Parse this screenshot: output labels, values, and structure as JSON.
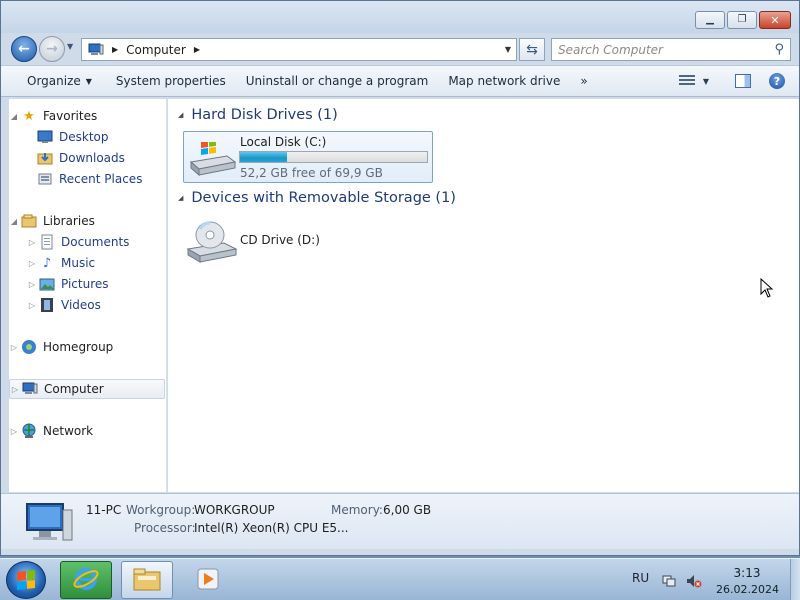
{
  "window": {
    "caption_buttons": {
      "minimize": "minimize-icon",
      "maximize": "maximize-icon",
      "close": "close-icon"
    }
  },
  "address_bar": {
    "breadcrumb": [
      "Computer"
    ],
    "search_placeholder": "Search Computer"
  },
  "toolbar": {
    "organize_label": "Organize",
    "items": [
      "System properties",
      "Uninstall or change a program",
      "Map network drive"
    ],
    "overflow_label": "»"
  },
  "nav_pane": {
    "favorites": {
      "label": "Favorites",
      "items": [
        "Desktop",
        "Downloads",
        "Recent Places"
      ]
    },
    "libraries": {
      "label": "Libraries",
      "items": [
        "Documents",
        "Music",
        "Pictures",
        "Videos"
      ]
    },
    "homegroup": "Homegroup",
    "computer": "Computer",
    "network": "Network"
  },
  "main": {
    "groups": [
      {
        "title": "Hard Disk Drives (1)",
        "drive": {
          "name": "Local Disk (C:)",
          "free_text": "52,2 GB free of 69,9 GB",
          "used_fraction": 0.253
        }
      },
      {
        "title": "Devices with Removable Storage (1)",
        "drive": {
          "name": "CD Drive (D:)"
        }
      }
    ]
  },
  "details": {
    "pc_name": "11-PC",
    "workgroup_label": "Workgroup:",
    "workgroup_value": "WORKGROUP",
    "memory_label": "Memory:",
    "memory_value": "6,00 GB",
    "processor_label": "Processor:",
    "processor_value": "Intel(R) Xeon(R) CPU E5..."
  },
  "taskbar": {
    "language": "RU",
    "time": "3:13",
    "date": "26.02.2024"
  },
  "colors": {
    "accent": "#1e3a78",
    "drive_bar_fill": "#1b95c7",
    "link": "#1e3e8c"
  }
}
